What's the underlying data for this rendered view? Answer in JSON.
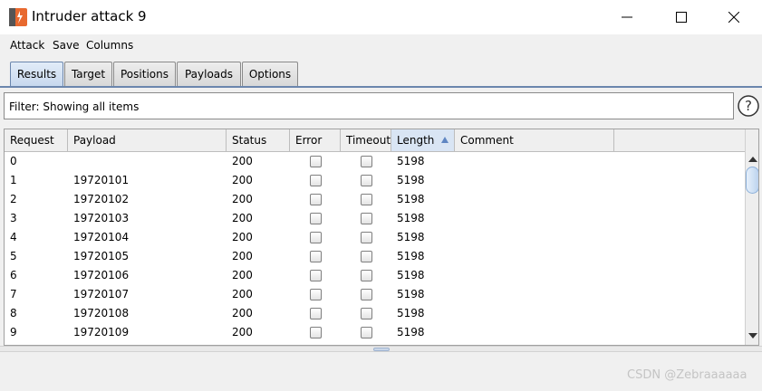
{
  "window": {
    "title": "Intruder attack 9",
    "icon": "burp-icon",
    "controls": [
      "minimize-icon",
      "maximize-icon",
      "close-icon"
    ]
  },
  "menu": [
    "Attack",
    "Save",
    "Columns"
  ],
  "tabs": [
    {
      "label": "Results",
      "active": true
    },
    {
      "label": "Target",
      "active": false
    },
    {
      "label": "Positions",
      "active": false
    },
    {
      "label": "Payloads",
      "active": false
    },
    {
      "label": "Options",
      "active": false
    }
  ],
  "filter": {
    "text": "Filter: Showing all items",
    "help_icon": "help-icon"
  },
  "table": {
    "columns": [
      "Request",
      "Payload",
      "Status",
      "Error",
      "Timeout",
      "Length",
      "Comment"
    ],
    "sorted_column": "Length",
    "sort_direction": "ascending",
    "rows": [
      {
        "request": "0",
        "payload": "",
        "status": "200",
        "error": false,
        "timeout": false,
        "length": "5198",
        "comment": ""
      },
      {
        "request": "1",
        "payload": "19720101",
        "status": "200",
        "error": false,
        "timeout": false,
        "length": "5198",
        "comment": ""
      },
      {
        "request": "2",
        "payload": "19720102",
        "status": "200",
        "error": false,
        "timeout": false,
        "length": "5198",
        "comment": ""
      },
      {
        "request": "3",
        "payload": "19720103",
        "status": "200",
        "error": false,
        "timeout": false,
        "length": "5198",
        "comment": ""
      },
      {
        "request": "4",
        "payload": "19720104",
        "status": "200",
        "error": false,
        "timeout": false,
        "length": "5198",
        "comment": ""
      },
      {
        "request": "5",
        "payload": "19720105",
        "status": "200",
        "error": false,
        "timeout": false,
        "length": "5198",
        "comment": ""
      },
      {
        "request": "6",
        "payload": "19720106",
        "status": "200",
        "error": false,
        "timeout": false,
        "length": "5198",
        "comment": ""
      },
      {
        "request": "7",
        "payload": "19720107",
        "status": "200",
        "error": false,
        "timeout": false,
        "length": "5198",
        "comment": ""
      },
      {
        "request": "8",
        "payload": "19720108",
        "status": "200",
        "error": false,
        "timeout": false,
        "length": "5198",
        "comment": ""
      },
      {
        "request": "9",
        "payload": "19720109",
        "status": "200",
        "error": false,
        "timeout": false,
        "length": "5198",
        "comment": ""
      }
    ]
  },
  "watermark": "CSDN @Zebraaaaaa",
  "colors": {
    "tab_accent": "#6b86ad",
    "sort_accent": "#5f86c2",
    "burp_orange": "#e8692f"
  }
}
